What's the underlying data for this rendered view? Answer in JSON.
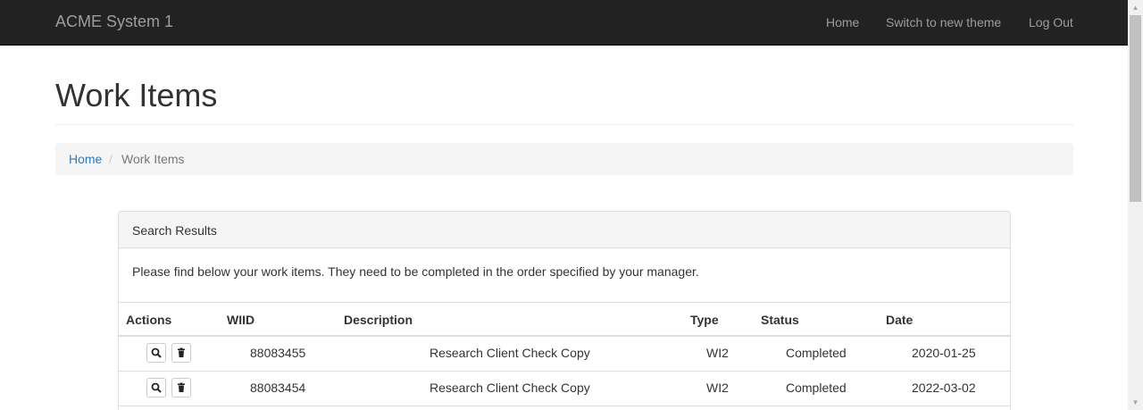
{
  "navbar": {
    "brand": "ACME System 1",
    "links": [
      {
        "label": "Home"
      },
      {
        "label": "Switch to new theme"
      },
      {
        "label": "Log Out"
      }
    ]
  },
  "page": {
    "title": "Work Items"
  },
  "breadcrumb": {
    "home": "Home",
    "separator": "/",
    "current": "Work Items"
  },
  "panel": {
    "heading": "Search Results",
    "intro": "Please find below your work items. They need to be completed in the order specified by your manager."
  },
  "table": {
    "columns": [
      "Actions",
      "WIID",
      "Description",
      "Type",
      "Status",
      "Date"
    ],
    "rows": [
      {
        "wiid": "88083455",
        "description": "Research Client Check Copy",
        "type": "WI2",
        "status": "Completed",
        "date": "2020-01-25"
      },
      {
        "wiid": "88083454",
        "description": "Research Client Check Copy",
        "type": "WI2",
        "status": "Completed",
        "date": "2022-03-02"
      }
    ],
    "action_icons": [
      "search-icon",
      "trash-icon"
    ]
  },
  "colors": {
    "navbar_bg": "#222222",
    "nav_text": "#9d9d9d",
    "link": "#337ab7",
    "breadcrumb_bg": "#f5f5f5",
    "panel_heading_bg": "#f5f5f5",
    "border": "#dddddd"
  }
}
